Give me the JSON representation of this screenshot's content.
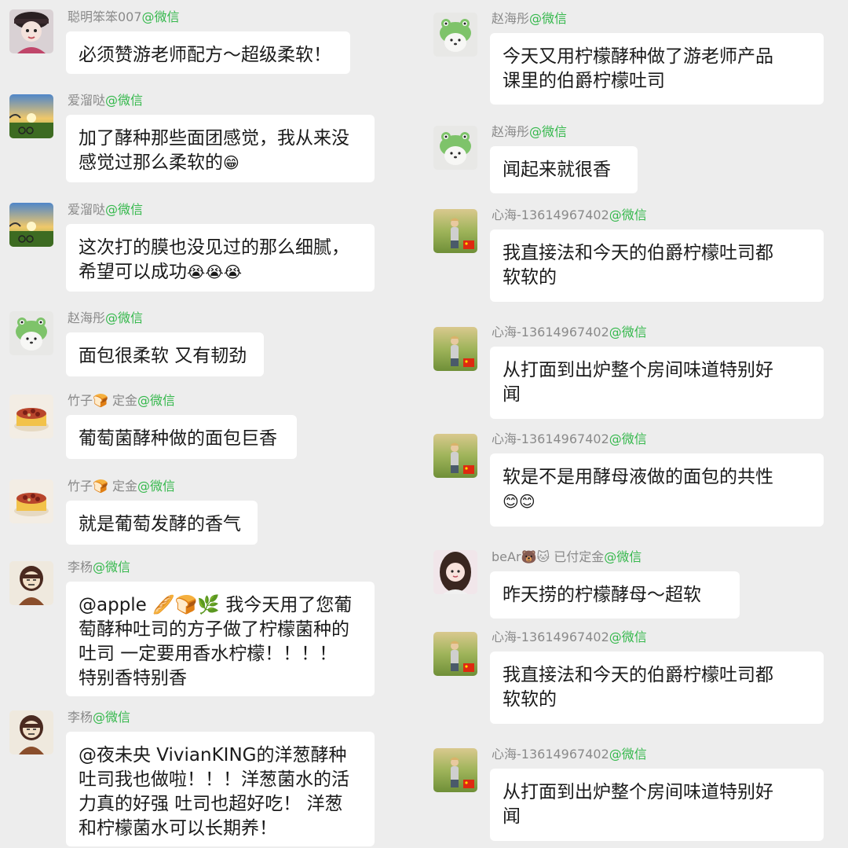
{
  "left_messages": [
    {
      "sender": "聪明笨笨007",
      "suffix": "@微信",
      "text": "必须赞游老师配方～超级柔软！"
    },
    {
      "sender": "爱溜哒",
      "suffix": "@微信",
      "text": "加了酵种那些面团感觉，我从来没\n感觉过那么柔软的",
      "emoji": "😁"
    },
    {
      "sender": "爱溜哒",
      "suffix": "@微信",
      "text": "这次打的膜也没见过的那么细腻，\n希望可以成功",
      "emoji": "😭😭😭"
    },
    {
      "sender": "赵海彤",
      "suffix": "@微信",
      "text": "面包很柔软 又有韧劲"
    },
    {
      "sender": "竹子🍞 定金",
      "suffix": "@微信",
      "text": "葡萄菌酵种做的面包巨香"
    },
    {
      "sender": "竹子🍞 定金",
      "suffix": "@微信",
      "text": "就是葡萄发酵的香气"
    },
    {
      "sender": "李杨",
      "suffix": "@微信",
      "text": "@apple 🥖🍞🌿 我今天用了您葡\n萄酵种吐司的方子做了柠檬菌种的\n吐司 一定要用香水柠檬！！！！\n特别香特别香"
    },
    {
      "sender": "李杨",
      "suffix": "@微信",
      "text": "@夜未央 VivianKING的洋葱酵种\n吐司我也做啦！！！洋葱菌水的活\n力真的好强 吐司也超好吃！ 洋葱\n和柠檬菌水可以长期养！"
    }
  ],
  "right_messages": [
    {
      "sender": "赵海彤",
      "suffix": "@微信",
      "text": "今天又用柠檬酵种做了游老师产品\n课里的伯爵柠檬吐司"
    },
    {
      "sender": "赵海彤",
      "suffix": "@微信",
      "text": "闻起来就很香"
    },
    {
      "sender": "心海-13614967402",
      "suffix": "@微信",
      "text": "我直接法和今天的伯爵柠檬吐司都\n软软的"
    },
    {
      "sender": "心海-13614967402",
      "suffix": "@微信",
      "text": "从打面到出炉整个房间味道特别好\n闻"
    },
    {
      "sender": "心海-13614967402",
      "suffix": "@微信",
      "text": "软是不是用酵母液做的面包的共性\n",
      "emoji": "😊😊"
    },
    {
      "sender": "beAr🐻🐱 已付定金",
      "suffix": "@微信",
      "text": "昨天捞的柠檬酵母～超软"
    },
    {
      "sender": "心海-13614967402",
      "suffix": "@微信",
      "text": "我直接法和今天的伯爵柠檬吐司都\n软软的"
    },
    {
      "sender": "心海-13614967402",
      "suffix": "@微信",
      "text": "从打面到出炉整个房间味道特别好\n闻"
    }
  ],
  "colors": {
    "background": "#ededed",
    "bubble": "#ffffff",
    "sender_name": "#8a8a8a",
    "wechat_tag": "#35b84c",
    "text": "#1a1a1a"
  },
  "avatar_icons": [
    "girl-avatar",
    "sunset-field-avatar",
    "frog-hat-dog-avatar",
    "cake-avatar",
    "cartoon-person-avatar",
    "field-person-avatar",
    "girl-selfie-avatar"
  ]
}
